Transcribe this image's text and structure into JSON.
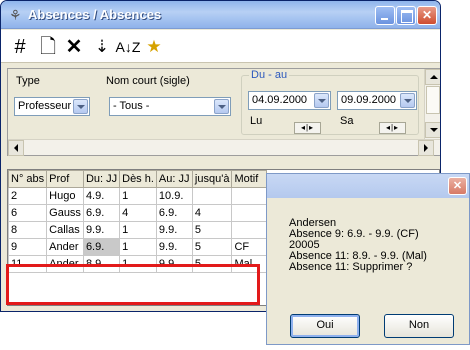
{
  "window": {
    "title": "Absences / Absences"
  },
  "toolbar": {
    "icons": [
      "grid-icon",
      "new-document-icon",
      "delete-icon",
      "import-icon",
      "sort-az-icon",
      "sort-color-icon"
    ]
  },
  "filters": {
    "type_label": "Type",
    "type_value": "Professeur",
    "short_name_label": "Nom court (sigle)",
    "short_name_value": "- Tous -",
    "range_label": "Du - au",
    "date_from": "04.09.2000",
    "date_to": "09.09.2000",
    "day_from": "Lu",
    "day_to": "Sa"
  },
  "table": {
    "columns": [
      "N° abs",
      "Prof",
      "Du: JJ",
      "Dès h.",
      "Au: JJ",
      "jusqu'à",
      "Motif"
    ],
    "rows": [
      [
        "2",
        "Hugo",
        "4.9.",
        "1",
        "10.9.",
        "",
        ""
      ],
      [
        "6",
        "Gauss",
        "6.9.",
        "4",
        "6.9.",
        "4",
        ""
      ],
      [
        "8",
        "Callas",
        "9.9.",
        "1",
        "9.9.",
        "5",
        ""
      ],
      [
        "9",
        "Ander",
        "6.9.",
        "1",
        "9.9.",
        "5",
        "CF"
      ],
      [
        "11",
        "Ander",
        "8.9.",
        "1",
        "9.9.",
        "5",
        "Mal"
      ]
    ]
  },
  "dialog": {
    "lines": [
      "Andersen",
      "Absence 9:  6.9. - 9.9. (CF)",
      "20005",
      "Absence 11:  8.9. - 9.9. (Mal)",
      "Absence 11:  Supprimer ?"
    ],
    "yes_label": "Oui",
    "no_label": "Non"
  },
  "colors": {
    "highlight_border": "#e21a1a",
    "title_blue": "#7ea3e6"
  }
}
